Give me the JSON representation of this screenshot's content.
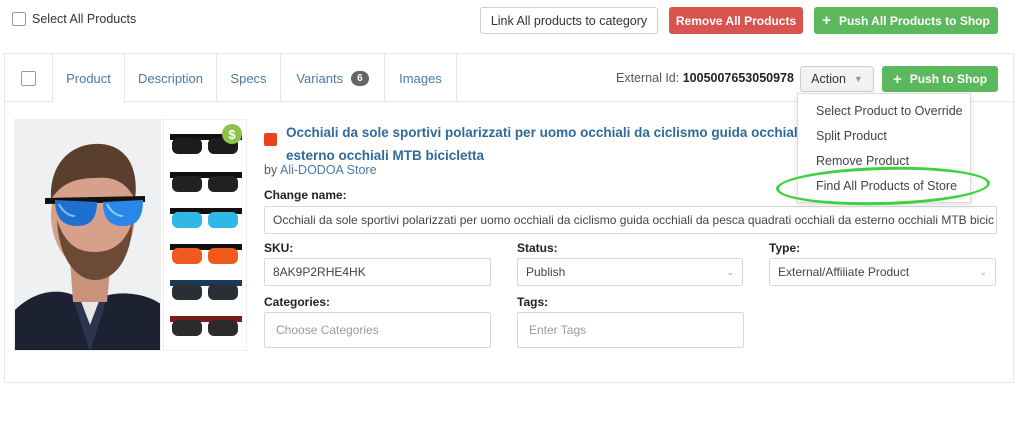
{
  "topbar": {
    "select_all_label": "Select All Products",
    "link_all_label": "Link All products to category",
    "remove_all_label": "Remove All Products",
    "push_all_label": "Push All Products to Shop"
  },
  "tabs": [
    {
      "label": "Product"
    },
    {
      "label": "Description"
    },
    {
      "label": "Specs"
    },
    {
      "label": "Variants",
      "badge": "6"
    },
    {
      "label": "Images"
    }
  ],
  "header": {
    "external_id_label": "External Id:",
    "external_id_value": "1005007653050978",
    "action_label": "Action",
    "push_label": "Push to Shop"
  },
  "action_menu": {
    "items": [
      "Select Product to Override",
      "Split Product",
      "Remove Product",
      "Find All Products of Store"
    ],
    "highlighted_item": "Find All Products of Store",
    "highlight_color": "#3fd23f"
  },
  "product": {
    "title_line1": "Occhiali da sole sportivi polarizzati per uomo occhiali da ciclismo guida occhiali da p",
    "title_line2": "esterno occhiali MTB bicicletta",
    "by_label": "by",
    "store_name": "Ali-DODOA Store",
    "change_name_label": "Change name:",
    "change_name_value": "Occhiali da sole sportivi polarizzati per uomo occhiali da ciclismo guida occhiali da pesca quadrati occhiali da esterno occhiali MTB bicic",
    "sku_label": "SKU:",
    "sku_value": "8AK9P2RHE4HK",
    "status_label": "Status:",
    "status_value": "Publish",
    "type_label": "Type:",
    "type_value": "External/Affiliate Product",
    "categories_label": "Categories:",
    "categories_placeholder": "Choose Categories",
    "tags_label": "Tags:",
    "tags_placeholder": "Enter Tags",
    "price_badge_symbol": "$"
  },
  "colors": {
    "remove_red": "#d9534f",
    "push_green": "#5cb85c",
    "link_blue": "#2f6a9a",
    "source_icon": "#e8431d"
  },
  "icons": [
    "checkbox-icon",
    "plus-icon",
    "chevron-down-icon",
    "aliexpress-icon",
    "dollar-icon"
  ]
}
